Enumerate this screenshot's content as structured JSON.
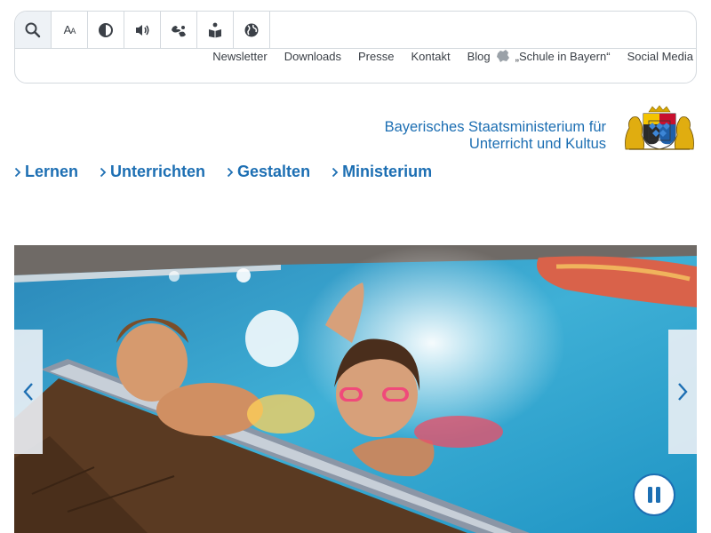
{
  "toolbar": {
    "items": [
      {
        "icon": "search-icon"
      },
      {
        "icon": "font-size-icon",
        "glyph": "AA"
      },
      {
        "icon": "contrast-icon"
      },
      {
        "icon": "read-aloud-icon"
      },
      {
        "icon": "sign-language-icon"
      },
      {
        "icon": "easy-language-icon"
      },
      {
        "icon": "language-globe-icon"
      }
    ]
  },
  "service_nav": {
    "newsletter": "Newsletter",
    "downloads": "Downloads",
    "presse": "Presse",
    "kontakt": "Kontakt",
    "blog": "Blog",
    "blog_name": "„Schule in Bayern“",
    "social_media": "Social Media"
  },
  "header": {
    "ministry_line1": "Bayerisches Staatsministerium für",
    "ministry_line2": "Unterricht und Kultus"
  },
  "main_nav": {
    "items": [
      "Lernen",
      "Unterrichten",
      "Gestalten",
      "Ministerium"
    ]
  },
  "colors": {
    "brand_blue": "#1d6fb3",
    "border": "#d4d9de"
  }
}
